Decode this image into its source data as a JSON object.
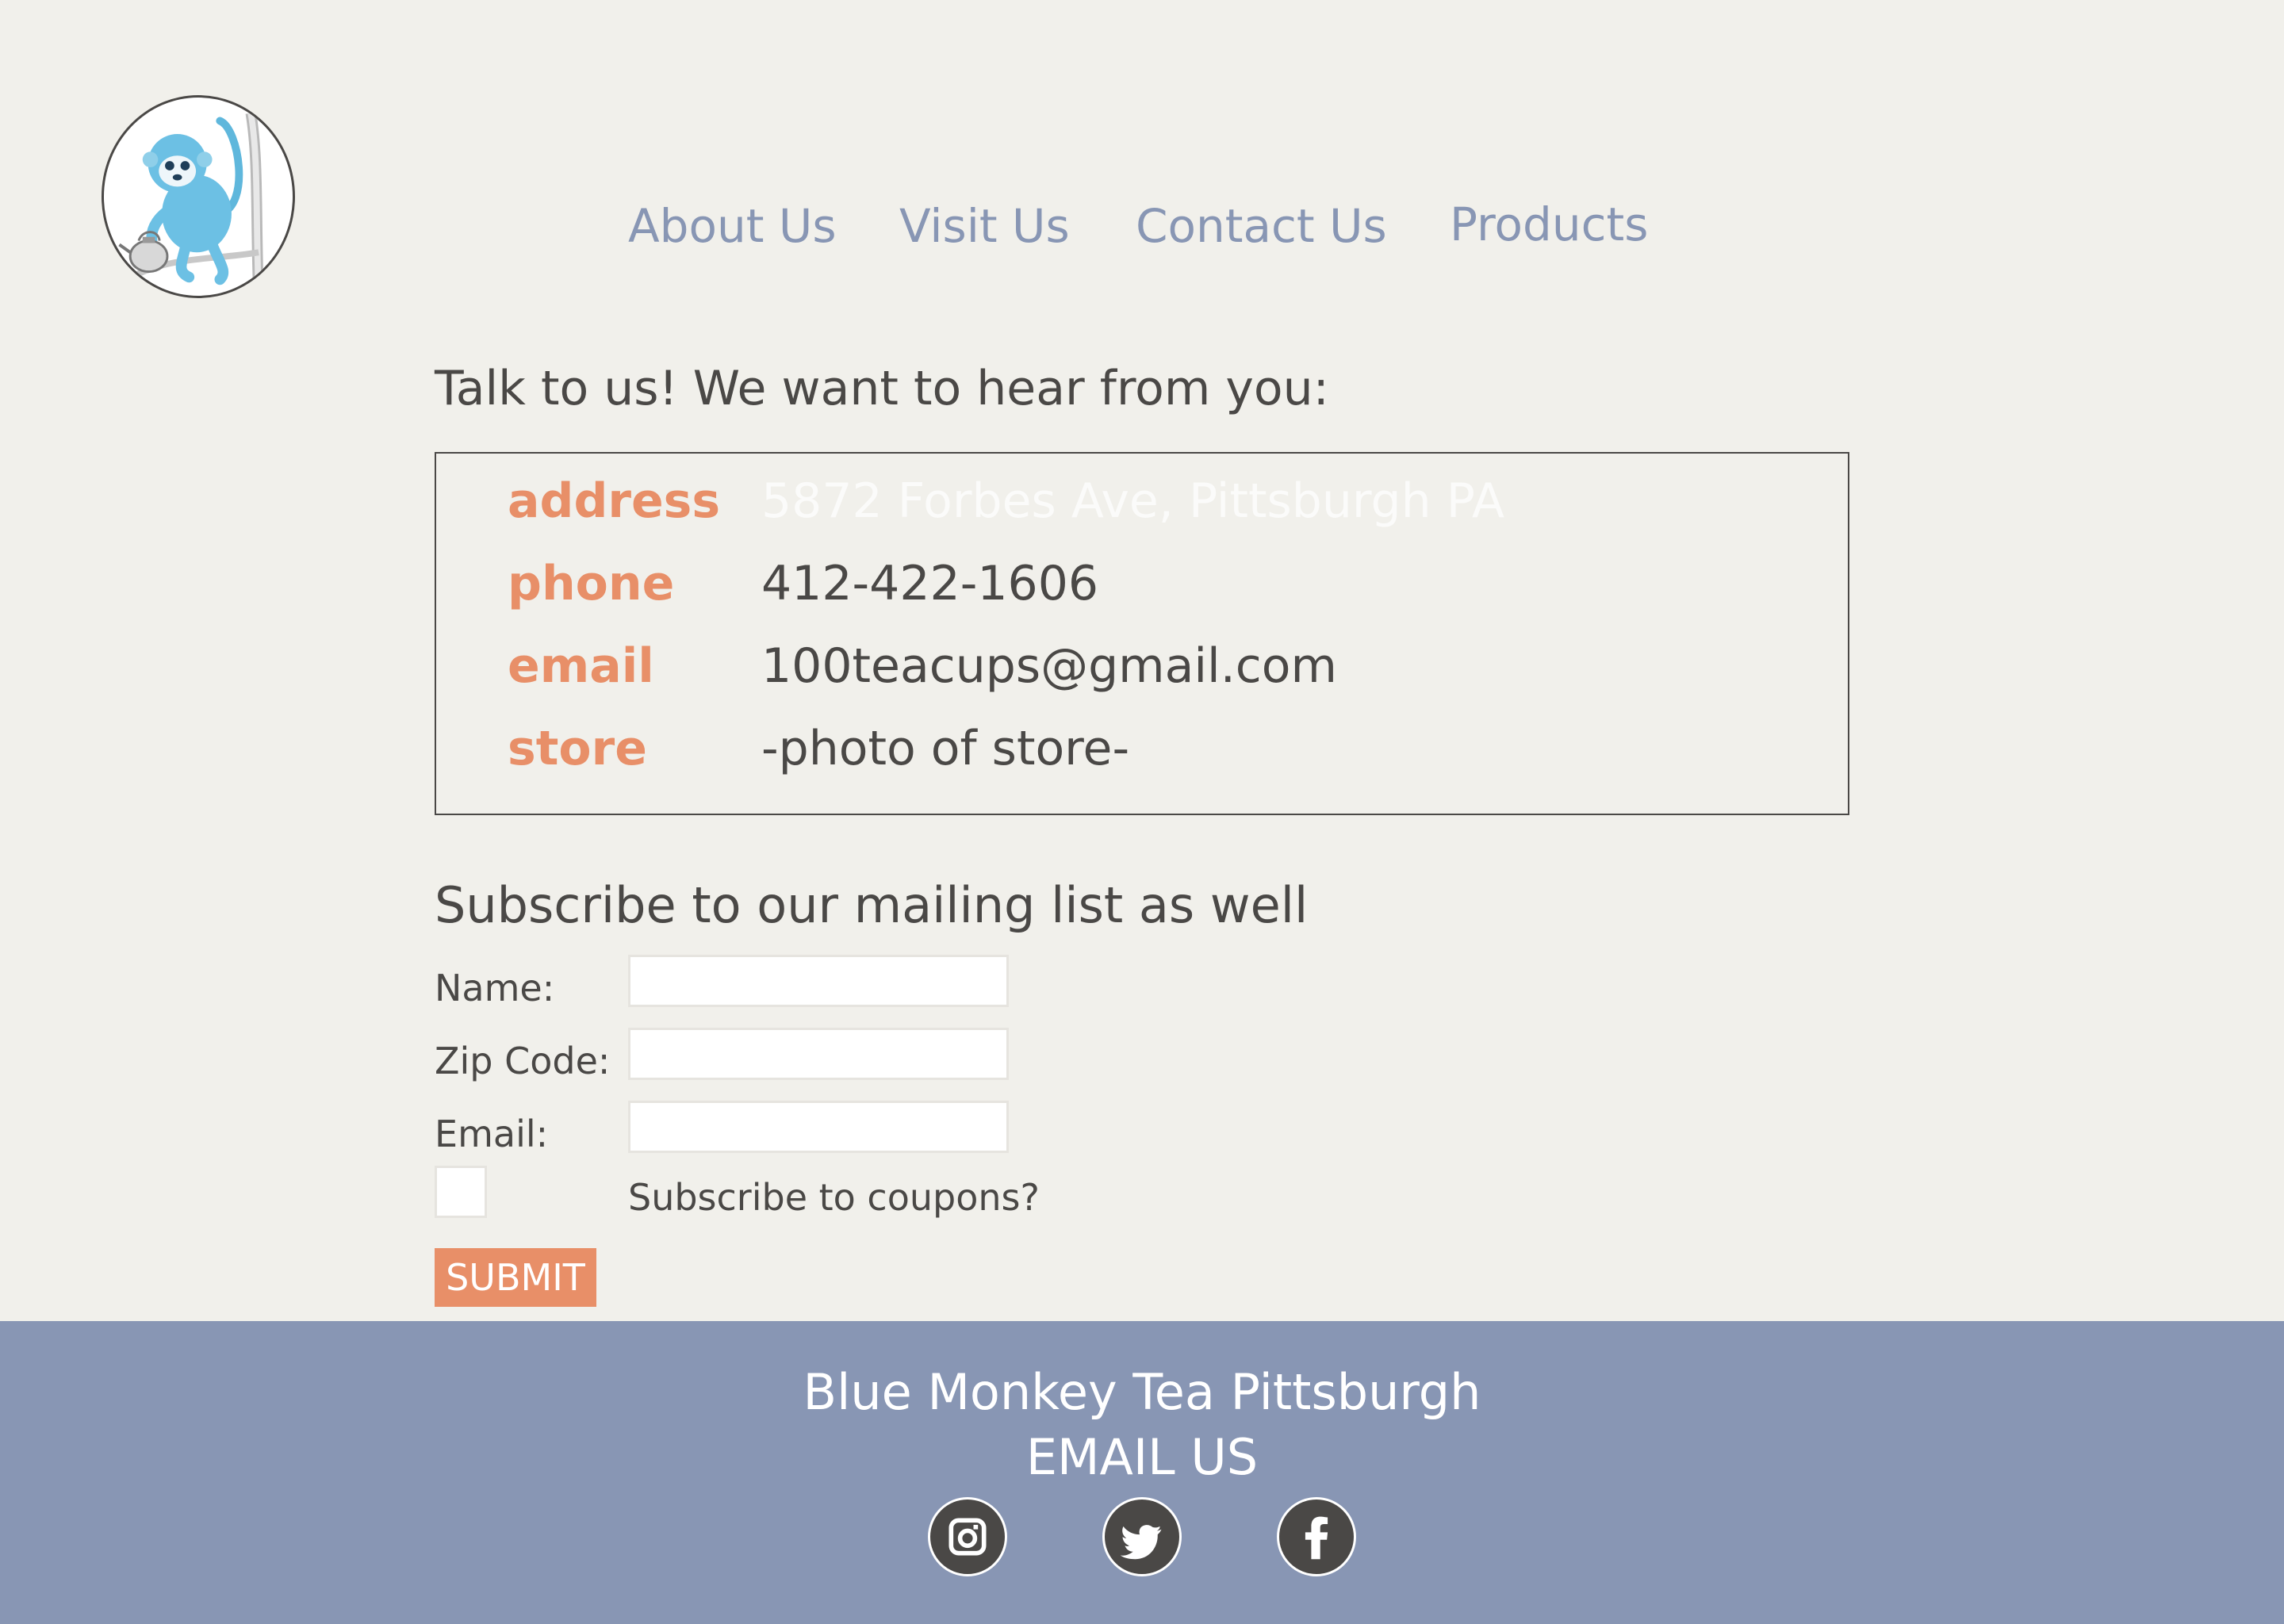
{
  "nav": {
    "items": [
      {
        "label": "About Us"
      },
      {
        "label": "Visit Us"
      },
      {
        "label": "Contact Us"
      },
      {
        "label": "Products"
      }
    ]
  },
  "intro": "Talk to us! We want to hear from you:",
  "contact": {
    "rows": [
      {
        "label": "address",
        "value": "5872 Forbes Ave, Pittsburgh PA"
      },
      {
        "label": "phone",
        "value": "412-422-1606"
      },
      {
        "label": "email",
        "value": "100teacups@gmail.com"
      },
      {
        "label": "store",
        "value": "-photo of store-"
      }
    ]
  },
  "subscribe": {
    "title": "Subscribe to our mailing list as well",
    "name_label": "Name:",
    "zip_label": "Zip Code:",
    "email_label": "Email:",
    "coupons_label": "Subscribe to coupons?",
    "submit_label": "SUBMIT",
    "name_value": "",
    "zip_value": "",
    "email_value": ""
  },
  "footer": {
    "brand": "Blue Monkey Tea Pittsburgh",
    "email_link": "EMAIL US",
    "social": [
      "instagram-icon",
      "twitter-icon",
      "facebook-icon"
    ]
  },
  "colors": {
    "background": "#f1f0eb",
    "nav_link": "#8896b4",
    "accent": "#e88f68",
    "footer": "#8896b4",
    "text": "#4a4846"
  },
  "logo": {
    "icon": "blue-monkey-logo"
  }
}
